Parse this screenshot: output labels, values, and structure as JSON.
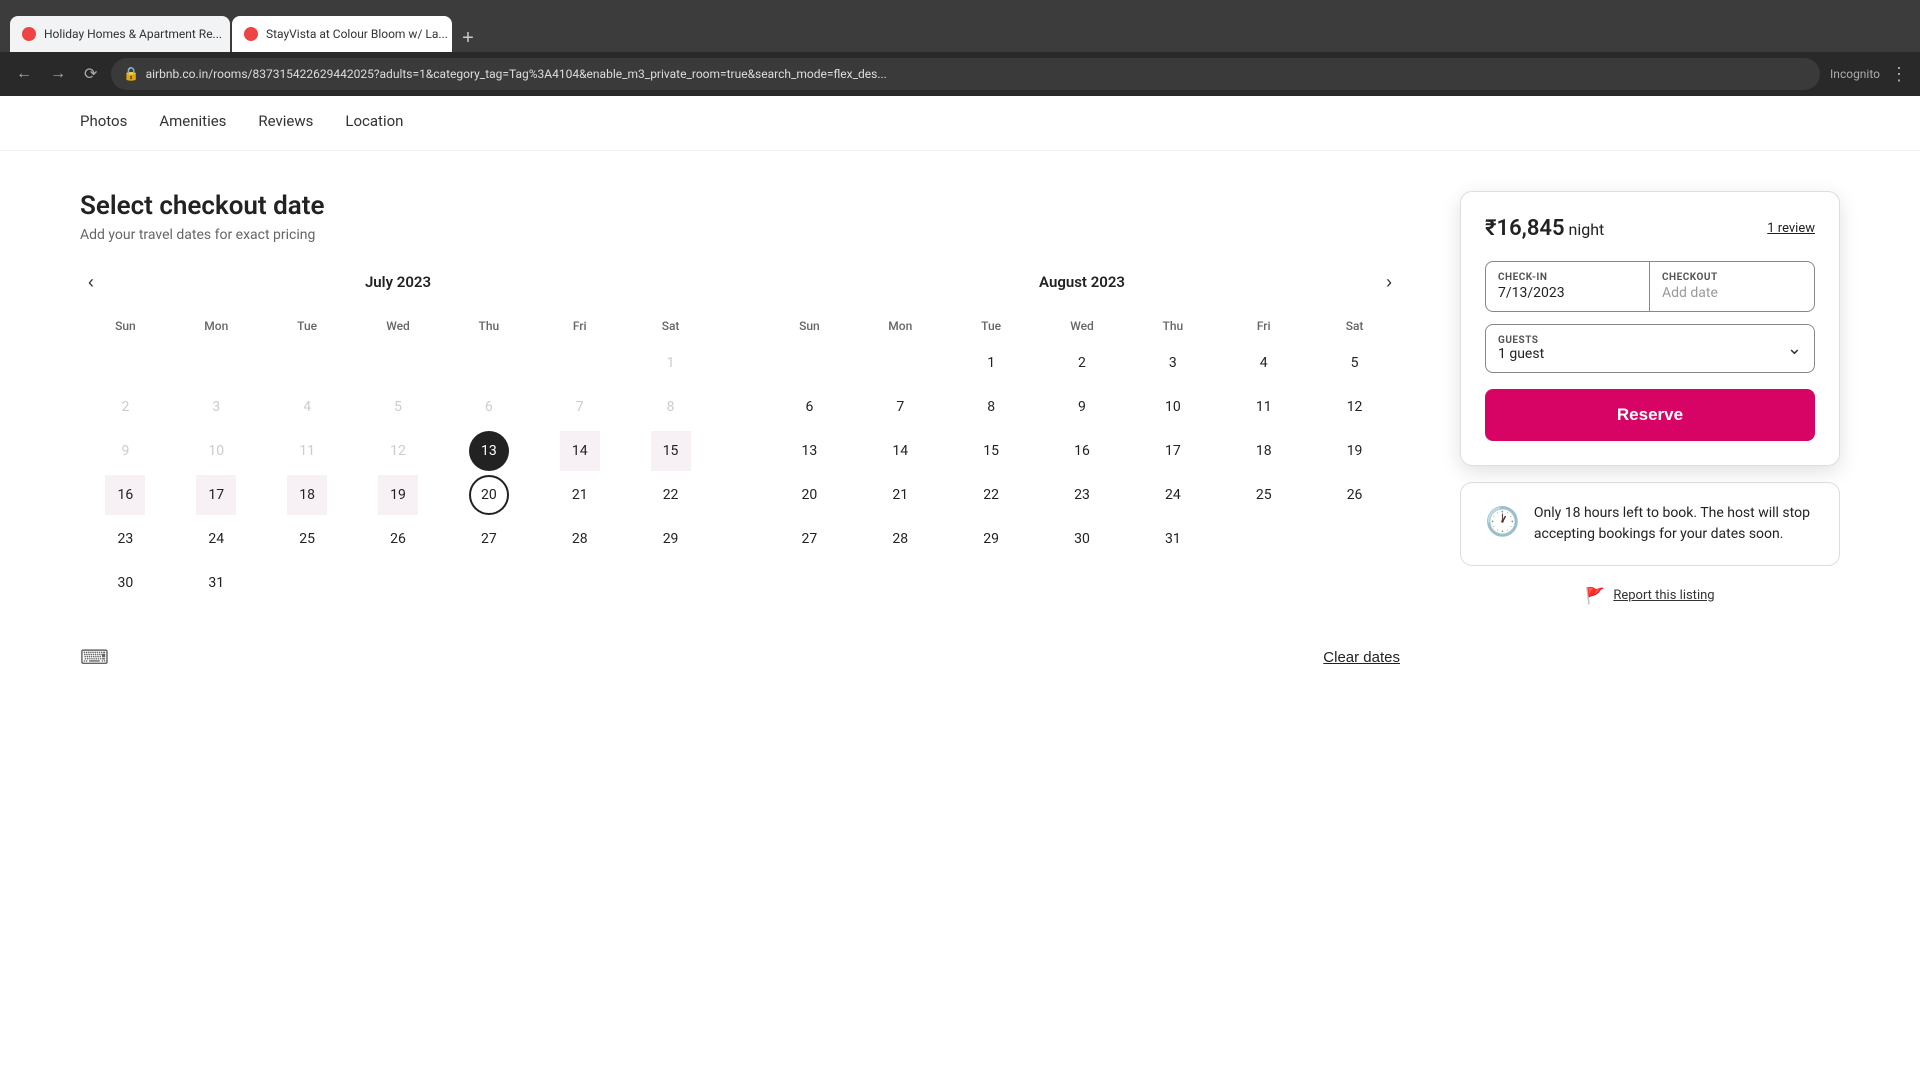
{
  "browser": {
    "tabs": [
      {
        "label": "Holiday Homes & Apartment Re...",
        "active": false
      },
      {
        "label": "StayVista at Colour Bloom w/ La...",
        "active": true
      }
    ],
    "address": "airbnb.co.in/rooms/837315422629442025?adults=1&category_tag=Tag%3A4104&enable_m3_private_room=true&search_mode=flex_des...",
    "incognito": "Incognito"
  },
  "nav": {
    "links": [
      "Photos",
      "Amenities",
      "Reviews",
      "Location"
    ]
  },
  "page": {
    "title": "Select checkout date",
    "subtitle": "Add your travel dates for exact pricing"
  },
  "calendar_left": {
    "month": "July 2023",
    "headers": [
      "Sun",
      "Mon",
      "Tue",
      "Wed",
      "Thu",
      "Fri",
      "Sat"
    ],
    "weeks": [
      [
        null,
        null,
        null,
        null,
        null,
        null,
        {
          "d": 1,
          "state": "disabled"
        }
      ],
      [
        {
          "d": 2,
          "state": "disabled"
        },
        {
          "d": 3,
          "state": "disabled"
        },
        {
          "d": 4,
          "state": "disabled"
        },
        {
          "d": 5,
          "state": "disabled"
        },
        {
          "d": 6,
          "state": "disabled"
        },
        {
          "d": 7,
          "state": "disabled"
        },
        {
          "d": 8,
          "state": "disabled"
        }
      ],
      [
        {
          "d": 9,
          "state": "disabled"
        },
        {
          "d": 10,
          "state": "disabled"
        },
        {
          "d": 11,
          "state": "disabled"
        },
        {
          "d": 12,
          "state": "disabled"
        },
        {
          "d": 13,
          "state": "selected-start"
        },
        {
          "d": 14,
          "state": "in-range"
        },
        {
          "d": 15,
          "state": "in-range"
        }
      ],
      [
        {
          "d": 16,
          "state": "in-range"
        },
        {
          "d": 17,
          "state": "in-range"
        },
        {
          "d": 18,
          "state": "in-range"
        },
        {
          "d": 19,
          "state": "in-range"
        },
        {
          "d": 20,
          "state": "hovered-end"
        },
        {
          "d": 21,
          "state": "normal"
        },
        {
          "d": 22,
          "state": "normal"
        }
      ],
      [
        {
          "d": 23,
          "state": "normal"
        },
        {
          "d": 24,
          "state": "normal"
        },
        {
          "d": 25,
          "state": "normal"
        },
        {
          "d": 26,
          "state": "normal"
        },
        {
          "d": 27,
          "state": "normal"
        },
        {
          "d": 28,
          "state": "normal"
        },
        {
          "d": 29,
          "state": "normal"
        }
      ],
      [
        {
          "d": 30,
          "state": "normal"
        },
        {
          "d": 31,
          "state": "normal"
        },
        null,
        null,
        null,
        null,
        null
      ]
    ]
  },
  "calendar_right": {
    "month": "August 2023",
    "headers": [
      "Sun",
      "Mon",
      "Tue",
      "Wed",
      "Thu",
      "Fri",
      "Sat"
    ],
    "weeks": [
      [
        null,
        null,
        {
          "d": 1,
          "state": "normal"
        },
        {
          "d": 2,
          "state": "normal"
        },
        {
          "d": 3,
          "state": "normal"
        },
        {
          "d": 4,
          "state": "normal"
        },
        {
          "d": 5,
          "state": "normal"
        }
      ],
      [
        {
          "d": 6,
          "state": "normal"
        },
        {
          "d": 7,
          "state": "normal"
        },
        {
          "d": 8,
          "state": "normal"
        },
        {
          "d": 9,
          "state": "normal"
        },
        {
          "d": 10,
          "state": "normal"
        },
        {
          "d": 11,
          "state": "normal"
        },
        {
          "d": 12,
          "state": "normal"
        }
      ],
      [
        {
          "d": 13,
          "state": "normal"
        },
        {
          "d": 14,
          "state": "normal"
        },
        {
          "d": 15,
          "state": "normal"
        },
        {
          "d": 16,
          "state": "normal"
        },
        {
          "d": 17,
          "state": "normal"
        },
        {
          "d": 18,
          "state": "normal"
        },
        {
          "d": 19,
          "state": "normal"
        }
      ],
      [
        {
          "d": 20,
          "state": "normal"
        },
        {
          "d": 21,
          "state": "normal"
        },
        {
          "d": 22,
          "state": "normal"
        },
        {
          "d": 23,
          "state": "normal"
        },
        {
          "d": 24,
          "state": "normal"
        },
        {
          "d": 25,
          "state": "normal"
        },
        {
          "d": 26,
          "state": "normal"
        }
      ],
      [
        {
          "d": 27,
          "state": "normal"
        },
        {
          "d": 28,
          "state": "normal"
        },
        {
          "d": 29,
          "state": "normal"
        },
        {
          "d": 30,
          "state": "normal"
        },
        {
          "d": 31,
          "state": "normal"
        },
        null,
        null
      ]
    ]
  },
  "footer": {
    "clear_dates": "Clear dates"
  },
  "booking": {
    "price": "₹16,845",
    "night_label": "night",
    "review_count": "1 review",
    "checkin_label": "CHECK-IN",
    "checkin_value": "7/13/2023",
    "checkout_label": "CHECKOUT",
    "checkout_placeholder": "Add date",
    "guests_label": "GUESTS",
    "guests_value": "1 guest",
    "reserve_label": "Reserve",
    "warning_text": "Only 18 hours left to book.  The host will stop accepting bookings for your dates soon.",
    "report_label": "Report this listing"
  }
}
